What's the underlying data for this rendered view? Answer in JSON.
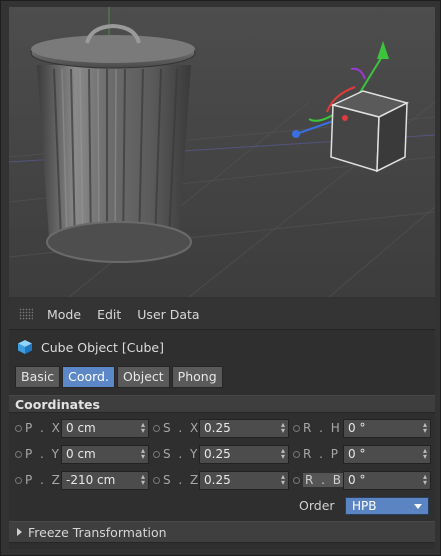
{
  "menu": {
    "mode": "Mode",
    "edit": "Edit",
    "user_data": "User Data"
  },
  "object": {
    "title": "Cube Object [Cube]"
  },
  "tabs": [
    {
      "label": "Basic",
      "active": false
    },
    {
      "label": "Coord.",
      "active": true
    },
    {
      "label": "Object",
      "active": false
    },
    {
      "label": "Phong",
      "active": false
    }
  ],
  "section": {
    "title": "Coordinates"
  },
  "coords": {
    "position": [
      {
        "label": "P . X",
        "value": "0 cm"
      },
      {
        "label": "P . Y",
        "value": "0 cm"
      },
      {
        "label": "P . Z",
        "value": "-210 cm"
      }
    ],
    "scale": [
      {
        "label": "S . X",
        "value": "0.25"
      },
      {
        "label": "S . Y",
        "value": "0.25"
      },
      {
        "label": "S . Z",
        "value": "0.25"
      }
    ],
    "rotation": [
      {
        "label": "R . H",
        "value": "0 °"
      },
      {
        "label": "R . P",
        "value": "0 °"
      },
      {
        "label": "R . B",
        "value": "0 °"
      }
    ]
  },
  "order": {
    "label": "Order",
    "value": "HPB"
  },
  "freeze": {
    "label": "Freeze Transformation"
  },
  "colors": {
    "accent": "#5c88c8",
    "axis_y": "#3cc43c",
    "axis_x": "#e03a3a",
    "axis_z": "#3a6fe0"
  }
}
